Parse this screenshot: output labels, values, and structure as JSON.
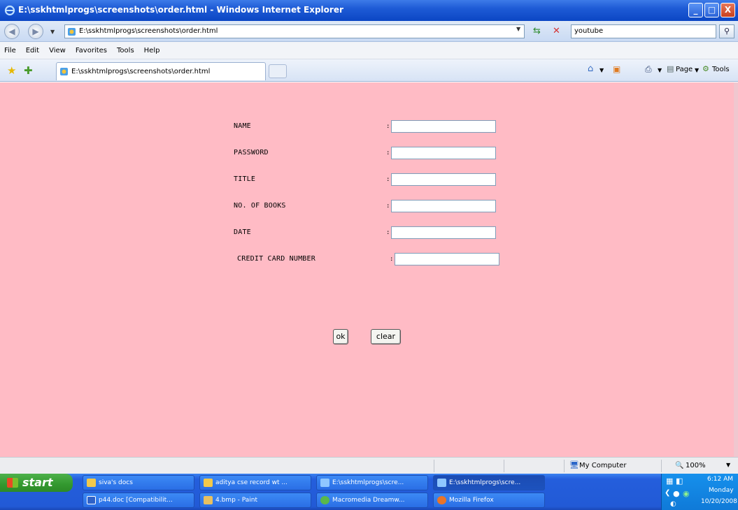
{
  "window": {
    "title": "E:\\sskhtmlprogs\\screenshots\\order.html - Windows Internet Explorer",
    "minimize": "_",
    "maximize": "□",
    "close": "X"
  },
  "address": {
    "url": "E:\\sskhtmlprogs\\screenshots\\order.html",
    "search_value": "youtube"
  },
  "menu": [
    "File",
    "Edit",
    "View",
    "Favorites",
    "Tools",
    "Help"
  ],
  "tab": {
    "label": "E:\\sskhtmlprogs\\screenshots\\order.html"
  },
  "commands": {
    "page": "Page",
    "tools": "Tools"
  },
  "form": {
    "fields": [
      {
        "label": "NAME",
        "value": ""
      },
      {
        "label": "PASSWORD",
        "value": ""
      },
      {
        "label": "TITLE",
        "value": ""
      },
      {
        "label": "NO. OF BOOKS",
        "value": ""
      },
      {
        "label": "DATE",
        "value": ""
      },
      {
        "label": "CREDIT CARD NUMBER",
        "value": ""
      }
    ],
    "colon": ":",
    "ok_label": "ok",
    "clear_label": "clear"
  },
  "status": {
    "zone": "My Computer",
    "zoom": "100%"
  },
  "taskbar": {
    "start": "start",
    "tasks": [
      {
        "label": "siva's docs"
      },
      {
        "label": "aditya cse record wt ..."
      },
      {
        "label": "E:\\sskhtmlprogs\\scre..."
      },
      {
        "label": "E:\\sskhtmlprogs\\scre..."
      },
      {
        "label": "p44.doc [Compatibilit..."
      },
      {
        "label": "4.bmp - Paint"
      },
      {
        "label": "Macromedia Dreamw..."
      },
      {
        "label": "Mozilla Firefox"
      }
    ],
    "clock_time": "6:12 AM",
    "clock_day": "Monday",
    "clock_date": "10/20/2008"
  }
}
